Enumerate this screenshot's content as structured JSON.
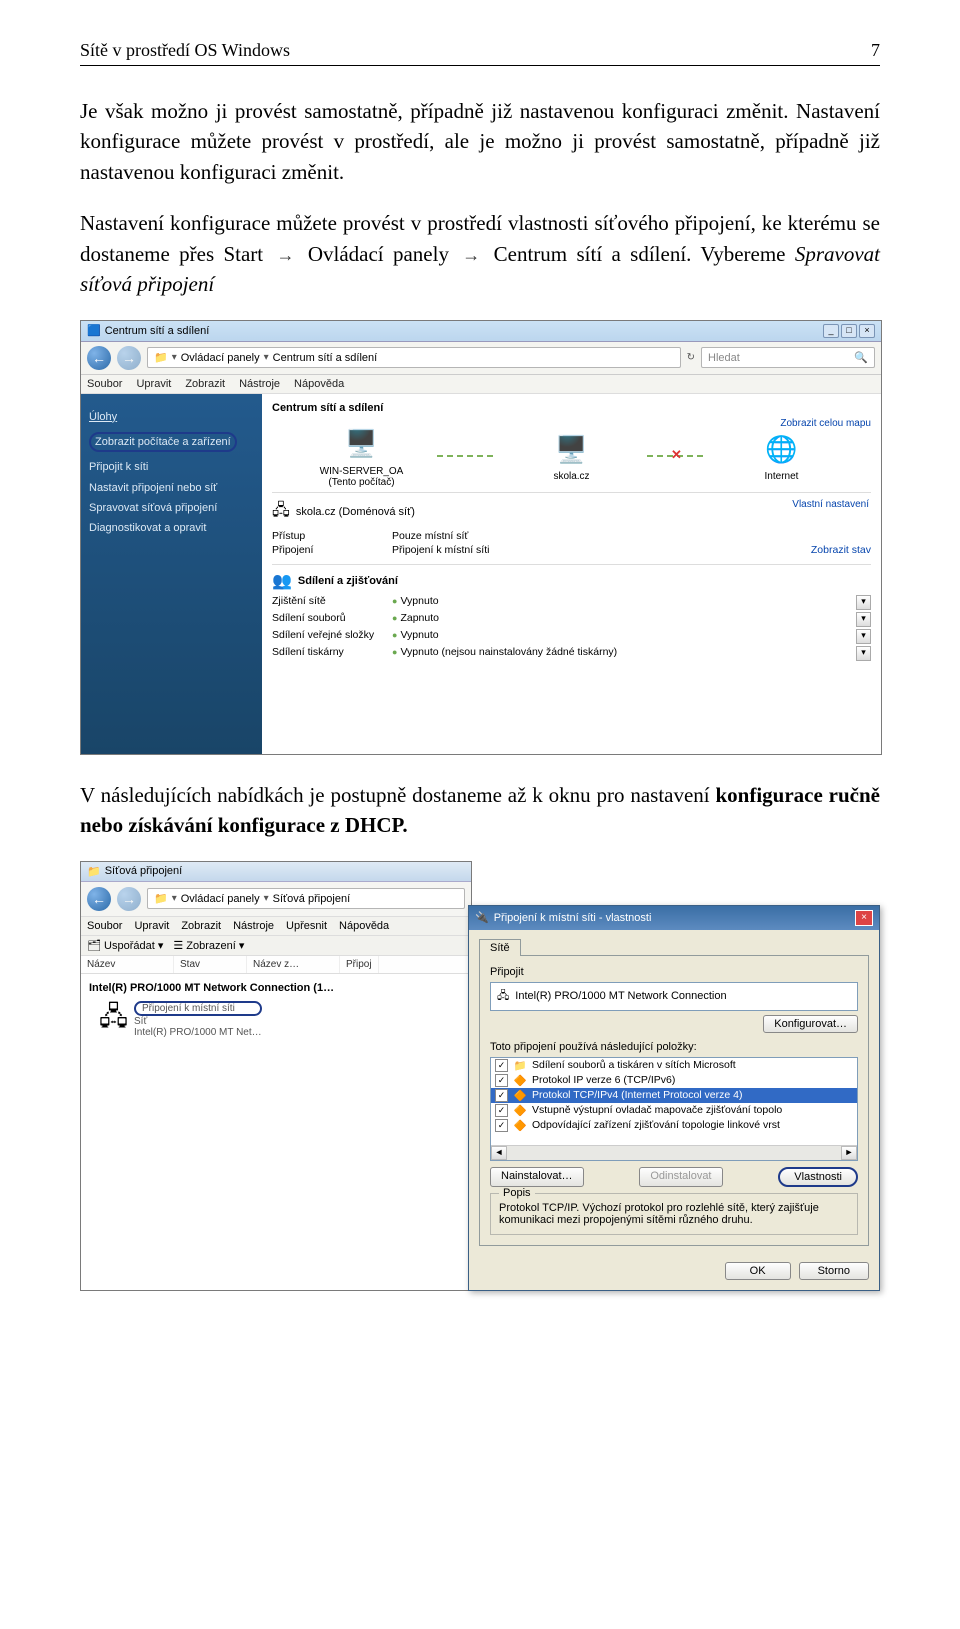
{
  "header": {
    "title": "Sítě v prostředí OS Windows",
    "page": "7"
  },
  "para1_a": "Je však možno ji provést samostatně, případně již nastavenou konfiguraci změnit.",
  "para1_b": "Nastavení konfigurace můžete provést v prostředí, ale je možno ji provést samostatně, případně již nastavenou konfiguraci změnit.",
  "para2_pre": "Nastavení konfigurace můžete provést v prostředí vlastnosti síťového připojení, ke kterému se dostaneme přes Start ",
  "para2_a": "Ovládací panely",
  "para2_b": "Centrum sítí a sdílení. Vybereme ",
  "para2_c": "Spravovat síťová připojení",
  "arrow": "→",
  "s1": {
    "title": "Centrum sítí a sdílení",
    "crumb1": "Ovládací panely",
    "crumb2": "Centrum sítí a sdílení",
    "search": "Hledat",
    "menu": [
      "Soubor",
      "Upravit",
      "Zobrazit",
      "Nástroje",
      "Nápověda"
    ],
    "side": {
      "head": "Úlohy",
      "i1": "Zobrazit počítače a zařízení",
      "i2": "Připojit k síti",
      "i3": "Nastavit připojení nebo síť",
      "i4": "Spravovat síťová připojení",
      "i5": "Diagnostikovat a opravit"
    },
    "mainhead": "Centrum sítí a sdílení",
    "mapright": "Zobrazit celou mapu",
    "map": {
      "n1a": "WIN-SERVER_OA",
      "n1b": "(Tento počítač)",
      "n2": "skola.cz",
      "n3": "Internet"
    },
    "sec_net": {
      "title": "skola.cz (Doménová síť)",
      "right": "Vlastní nastavení",
      "r1k": "Přístup",
      "r1v": "Pouze místní síť",
      "r2k": "Připojení",
      "r2v": "Připojení k místní síti",
      "r2r": "Zobrazit stav"
    },
    "sec_share": {
      "title": "Sdílení a zjišťování",
      "r1k": "Zjištění sítě",
      "r1v": "Vypnuto",
      "r2k": "Sdílení souborů",
      "r2v": "Zapnuto",
      "r3k": "Sdílení veřejné složky",
      "r3v": "Vypnuto",
      "r4k": "Sdílení tiskárny",
      "r4v": "Vypnuto (nejsou nainstalovány žádné tiskárny)"
    }
  },
  "para3": "V následujících nabídkách je postupně dostaneme až k oknu pro nastavení ",
  "para3_b": "konfigurace ručně nebo získávání konfigurace z DHCP.",
  "s2": {
    "left": {
      "title": "Síťová připojení",
      "crumb1": "Ovládací panely",
      "crumb2": "Síťová připojení",
      "menu": [
        "Soubor",
        "Upravit",
        "Zobrazit",
        "Nástroje",
        "Upřesnit",
        "Nápověda"
      ],
      "tb1": "Uspořádat",
      "tb2": "Zobrazení",
      "cols": [
        "Název",
        "Stav",
        "Název z…",
        "Připoj"
      ],
      "group": "Intel(R) PRO/1000 MT Network Connection (1…",
      "conn": "Připojení k místní síti",
      "conn_s1": "Síť",
      "conn_s2": "Intel(R) PRO/1000 MT Net…"
    },
    "right": {
      "title": "Připojení k místní síti - vlastnosti",
      "tab": "Sítě",
      "lbl_connect": "Připojit",
      "adapter": "Intel(R) PRO/1000 MT Network Connection",
      "btn_conf": "Konfigurovat…",
      "lbl_uses": "Toto připojení používá následující položky:",
      "items": [
        "Sdílení souborů a tiskáren v sítích Microsoft",
        "Protokol IP verze 6 (TCP/IPv6)",
        "Protokol TCP/IPv4 (Internet Protocol verze 4)",
        "Vstupně výstupní ovladač mapovače zjišťování topolo",
        "Odpovídající zařízení zjišťování topologie linkové vrst"
      ],
      "btn_install": "Nainstalovat…",
      "btn_uninstall": "Odinstalovat",
      "btn_props": "Vlastnosti",
      "popis": "Popis",
      "popis_text": "Protokol TCP/IP. Výchozí protokol pro rozlehlé sítě, který zajišťuje komunikaci mezi propojenými sítěmi různého druhu.",
      "ok": "OK",
      "cancel": "Storno"
    }
  }
}
